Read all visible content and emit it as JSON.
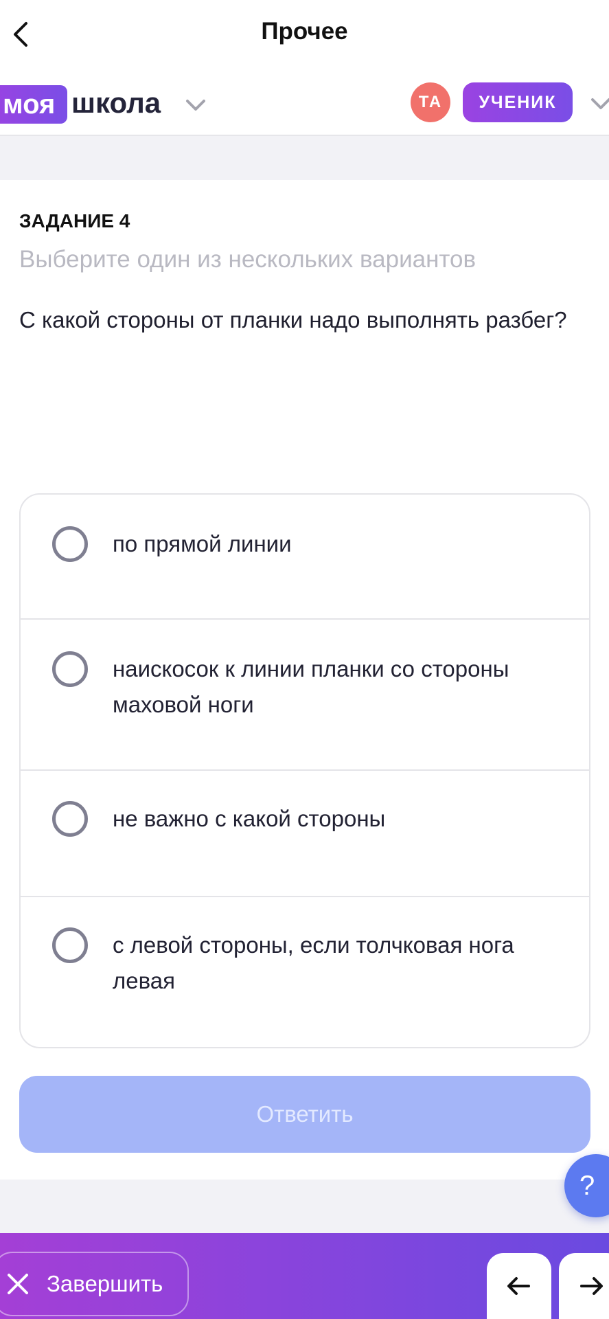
{
  "header": {
    "title": "Прочее",
    "back_icon": "chevron-left-icon"
  },
  "school": {
    "brand_highlight": "моя",
    "brand_text": "школа",
    "user_initials": "ТА",
    "role": "УЧЕНИК"
  },
  "task": {
    "number_label": "ЗАДАНИЕ 4",
    "hint": "Выберите один из нескольких вариантов",
    "question": "С какой стороны от планки надо выполнять разбег?",
    "options": [
      {
        "label": "по прямой линии",
        "selected": false
      },
      {
        "label": "наискосок к линии планки со стороны маховой ноги",
        "selected": false
      },
      {
        "label": "не важно с какой стороны",
        "selected": false
      },
      {
        "label": "с левой стороны, если толчковая нога левая",
        "selected": false
      }
    ],
    "submit_label": "Ответить"
  },
  "help": {
    "label": "?"
  },
  "footer": {
    "finish_label": "Завершить",
    "prev_icon": "arrow-left-icon",
    "next_icon": "arrow-right-icon"
  },
  "colors": {
    "accent_purple": "#8a44dc",
    "avatar_red": "#f1716b",
    "submit_disabled": "#a4b5f8",
    "help_blue": "#5c7af0"
  }
}
